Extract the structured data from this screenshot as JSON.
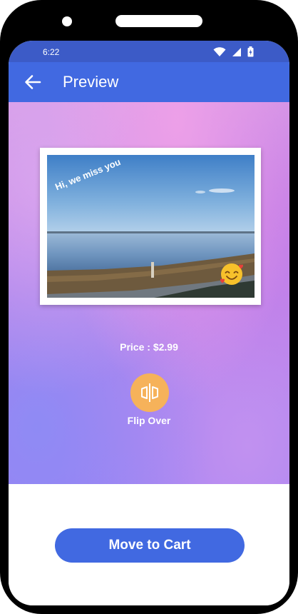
{
  "status_bar": {
    "time": "6:22",
    "icons": [
      "wifi-icon",
      "signal-icon",
      "battery-charging-icon"
    ]
  },
  "app_bar": {
    "back_icon": "arrow-left-icon",
    "title": "Preview"
  },
  "card": {
    "message": "Hi, we miss you",
    "sticker": "smiling-face-with-hearts-emoji"
  },
  "price_text": "Price : $2.99",
  "flip": {
    "icon": "flip-icon",
    "label": "Flip Over"
  },
  "cart_button_label": "Move to Cart",
  "colors": {
    "app_bar": "#4169E1",
    "status_bar": "#3C5BC7",
    "flip_button": "#F6B25A",
    "cart_button": "#4169E1"
  }
}
